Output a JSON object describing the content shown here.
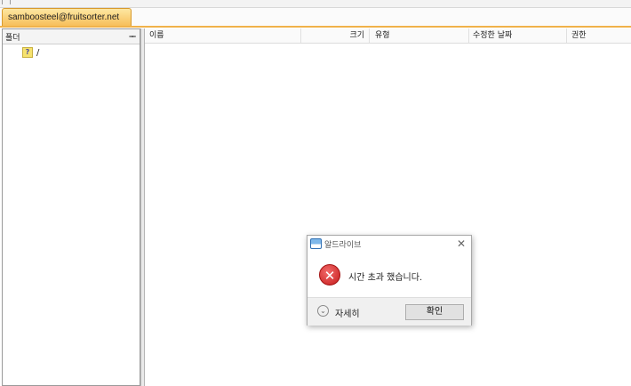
{
  "tab": {
    "label": "samboosteel@fruitsorter.net"
  },
  "folder_panel": {
    "title": "폴더",
    "pin_glyph": "ᆍ",
    "tree": [
      {
        "icon": "unknown-folder-icon",
        "glyph": "?",
        "label": "/"
      }
    ]
  },
  "file_list": {
    "columns": {
      "name": "이름",
      "size": "크기",
      "type": "유형",
      "modified": "수정한 날짜",
      "permission": "권한"
    },
    "rows": []
  },
  "dialog": {
    "app_title": "알드라이브",
    "close_glyph": "✕",
    "error_glyph": "✕",
    "message": "시간 초과 했습니다.",
    "details_glyph": "⌄",
    "details_label": "자세히",
    "ok_label": "확인"
  },
  "colors": {
    "tab_bg": "#f7bf5a",
    "accent_line": "#f0b24a",
    "error_red": "#c61c1c"
  }
}
